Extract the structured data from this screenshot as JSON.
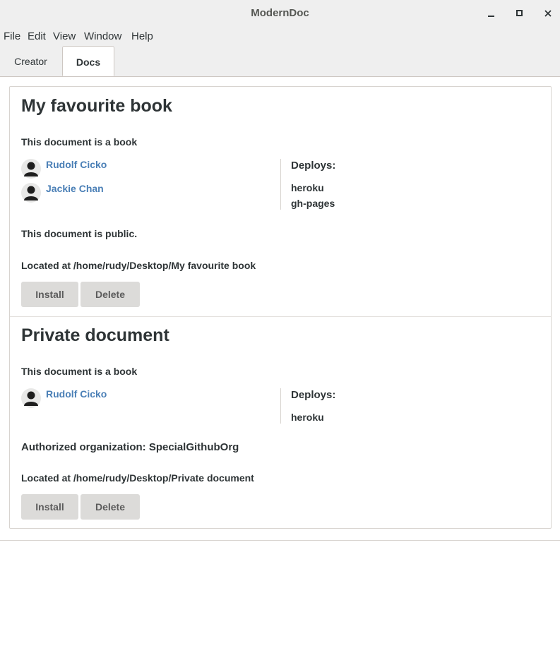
{
  "window": {
    "title": "ModernDoc"
  },
  "menubar": {
    "items": [
      "File",
      "Edit",
      "View",
      "Window",
      "Help"
    ]
  },
  "tabs": [
    {
      "label": "Creator",
      "active": false
    },
    {
      "label": "Docs",
      "active": true
    }
  ],
  "documents": [
    {
      "title": "My favourite book",
      "type_text": "This document is a book",
      "authors": [
        "Rudolf Cicko",
        "Jackie Chan"
      ],
      "deploys_label": "Deploys:",
      "deploys": [
        "heroku",
        "gh-pages"
      ],
      "access_text": "This document is public.",
      "location_text": "Located at /home/rudy/Desktop/My favourite book",
      "install_label": "Install",
      "delete_label": "Delete"
    },
    {
      "title": "Private document",
      "type_text": "This document is a book",
      "authors": [
        "Rudolf Cicko"
      ],
      "deploys_label": "Deploys:",
      "deploys": [
        "heroku"
      ],
      "access_text": "Authorized organization: SpecialGithubOrg",
      "location_text": "Located at /home/rudy/Desktop/Private document",
      "install_label": "Install",
      "delete_label": "Delete"
    }
  ],
  "colors": {
    "link": "#4a7fb6",
    "chrome_bg": "#efefef",
    "button_bg": "#dcdbd9"
  }
}
